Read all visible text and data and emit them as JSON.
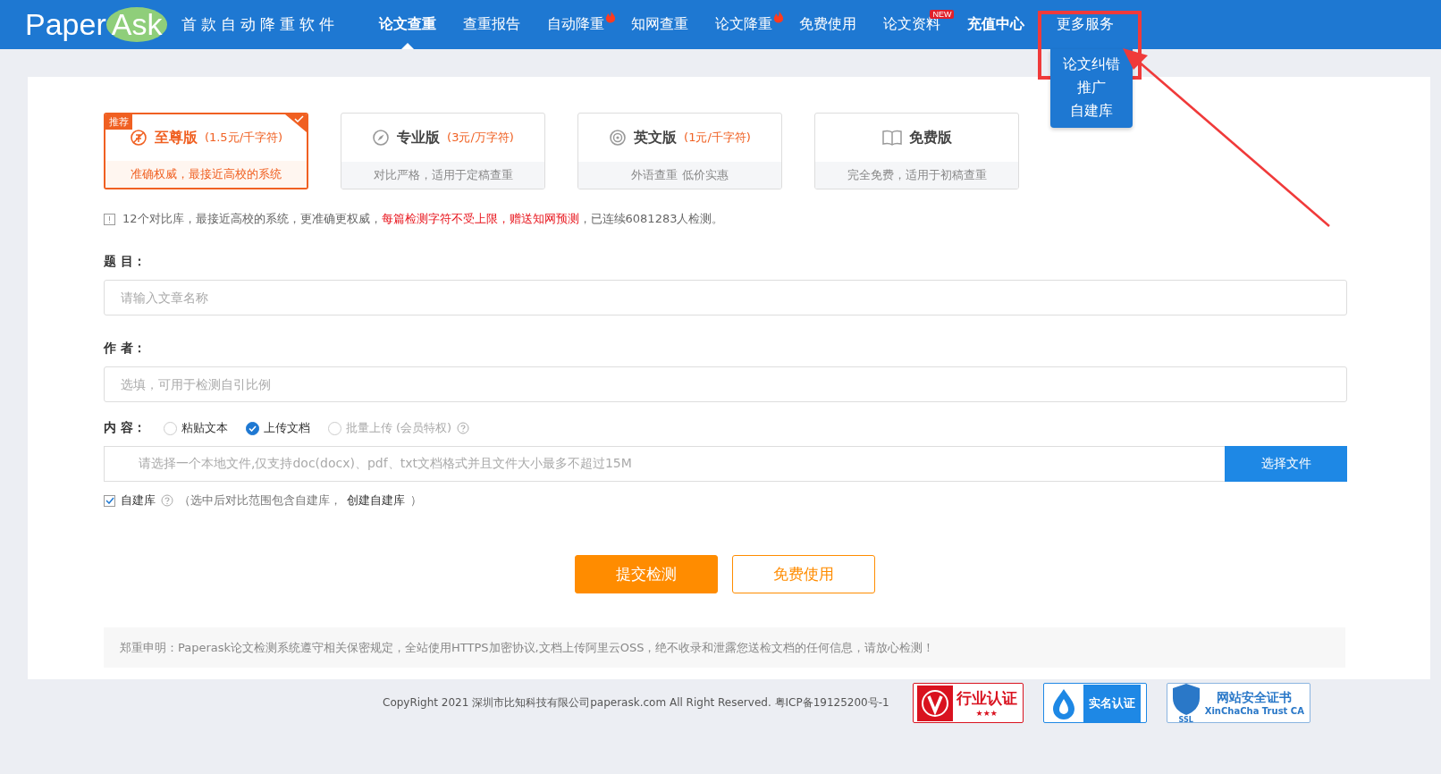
{
  "logo": {
    "part_a": "Paper",
    "part_b": "Ask"
  },
  "slogan": "首款自动降重软件",
  "nav": [
    {
      "label": "论文查重",
      "selected": true,
      "bold": true,
      "hot": false
    },
    {
      "label": "查重报告",
      "selected": false,
      "bold": false,
      "hot": false
    },
    {
      "label": "自动降重",
      "selected": false,
      "bold": false,
      "hot": true
    },
    {
      "label": "知网查重",
      "selected": false,
      "bold": false,
      "hot": false
    },
    {
      "label": "论文降重",
      "selected": false,
      "bold": false,
      "hot": true
    },
    {
      "label": "免费使用",
      "selected": false,
      "bold": false,
      "hot": false
    },
    {
      "label": "论文资料",
      "selected": false,
      "bold": false,
      "hot": false,
      "tag": "NEW"
    },
    {
      "label": "充值中心",
      "selected": false,
      "bold": true,
      "hot": false
    }
  ],
  "more_menu": {
    "label": "更多服务",
    "highlighted": true,
    "items": [
      "论文纠错",
      "推广",
      "自建库"
    ]
  },
  "plans": [
    {
      "kind": "premium",
      "name": "至尊版",
      "price": "(1.5元/千字符)",
      "desc": "准确权威，最接近高校的系统",
      "selected": true,
      "badge": "推荐"
    },
    {
      "kind": "pro",
      "name": "专业版",
      "price": "(3元/万字符)",
      "desc": "对比严格，适用于定稿查重",
      "selected": false
    },
    {
      "kind": "english",
      "name": "英文版",
      "price": "(1元/千字符)",
      "desc": "外语查重 低价实惠",
      "selected": false
    },
    {
      "kind": "free",
      "name": "免费版",
      "desc": "完全免费，适用于初稿查重",
      "selected": false
    }
  ],
  "info": [
    {
      "text": "12个对比库，最接近高校的系统，更准确更权威，",
      "highlight": false
    },
    {
      "text": "每篇检测字符不受上限，赠送知网预测",
      "highlight": true
    },
    {
      "text": "，已连续6081283人检测。",
      "highlight": false
    }
  ],
  "form": {
    "title_label": "题 目：",
    "title_placeholder": "请输入文章名称",
    "author_label": "作 者：",
    "author_placeholder": "选填，可用于检测自引比例",
    "content_label": "内 容：",
    "modes": [
      {
        "label": "粘贴文本",
        "selected": false,
        "disabled": false
      },
      {
        "label": "上传文档",
        "selected": true,
        "disabled": false
      },
      {
        "label": "批量上传 (会员特权)",
        "selected": false,
        "disabled": true
      }
    ],
    "file_placeholder": "请选择一个本地文件,仅支持doc(docx)、pdf、txt文档格式并且文件大小最多不超过15M",
    "file_button": "选择文件",
    "own_db": {
      "checked": true,
      "label": "自建库",
      "note": "（选中后对比范围包含自建库，",
      "link": "创建自建库",
      "note_end": "）"
    }
  },
  "actions": {
    "submit": "提交检测",
    "free": "免费使用"
  },
  "notice": "郑重申明：Paperask论文检测系统遵守相关保密规定，全站使用HTTPS加密协议,文档上传阿里云OSS，绝不收录和泄露您送检文档的任何信息，请放心检测！",
  "footer": {
    "copyright": "CopyRight 2021 深圳市比知科技有限公司paperask.com All Right Reserved. 粤ICP备19125200号-1",
    "badges": [
      {
        "kind": "industry",
        "title": "行业认证",
        "sub": "★★★"
      },
      {
        "kind": "realname",
        "title": "实名认证"
      },
      {
        "kind": "ssl",
        "title": "网站安全证书",
        "sub": "XinChaCha Trust CA",
        "tag": "SSL"
      }
    ]
  }
}
